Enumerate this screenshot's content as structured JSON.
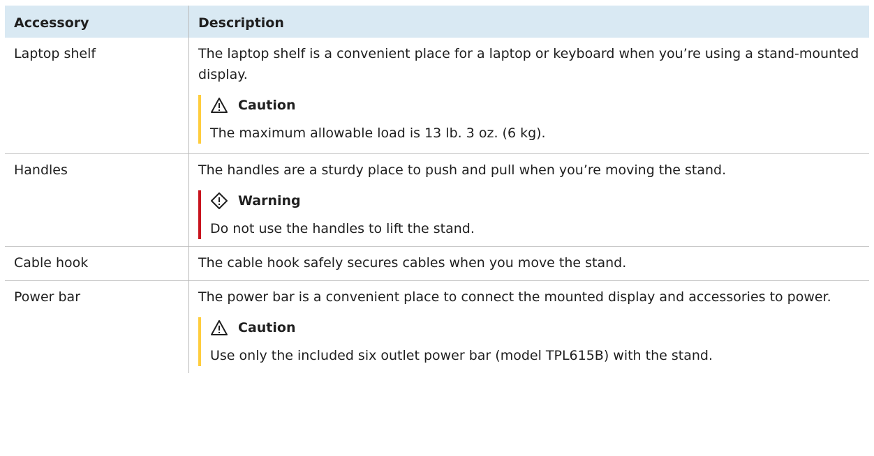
{
  "table": {
    "headers": {
      "accessory": "Accessory",
      "description": "Description"
    },
    "rows": [
      {
        "accessory": "Laptop shelf",
        "description": "The laptop shelf is a convenient place for a laptop or keyboard when you’re using a stand-mounted display.",
        "note": {
          "type": "caution",
          "title": "Caution",
          "text": "The maximum allowable load is 13 lb. 3 oz. (6 kg)."
        }
      },
      {
        "accessory": "Handles",
        "description": "The handles are a sturdy place to push and pull when you’re moving the stand.",
        "note": {
          "type": "warning",
          "title": "Warning",
          "text": "Do not use the handles to lift the stand."
        }
      },
      {
        "accessory": "Cable hook",
        "description": "The cable hook safely secures cables when you move the stand."
      },
      {
        "accessory": "Power bar",
        "description": "The power bar is a convenient place to connect the mounted display and accessories to power.",
        "note": {
          "type": "caution",
          "title": "Caution",
          "text": "Use only the included six outlet power bar (model TPL615B) with the stand."
        }
      }
    ]
  },
  "colors": {
    "header_bg": "#d9e9f3",
    "caution_bar": "#ffcd3d",
    "warning_bar": "#c8141e"
  },
  "icons": {
    "caution": "caution-triangle-icon",
    "warning": "warning-diamond-icon"
  }
}
